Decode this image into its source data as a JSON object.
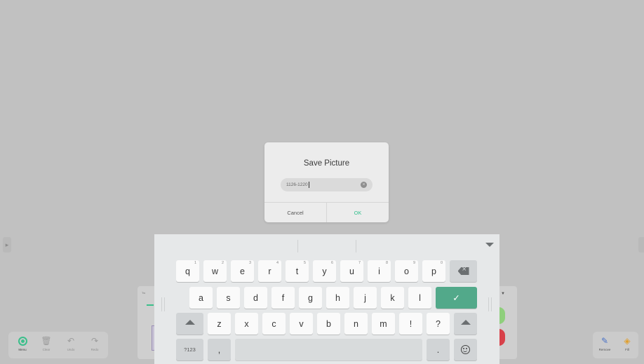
{
  "dialog": {
    "title": "Save Picture",
    "filename_value": "1126-1220",
    "cancel_label": "Cancel",
    "ok_label": "OK"
  },
  "toolbar_left": {
    "items": [
      {
        "label": "Menu",
        "icon": "menu-icon"
      },
      {
        "label": "Clear",
        "icon": "trash-icon"
      },
      {
        "label": "Undo",
        "icon": "undo-icon"
      },
      {
        "label": "Redo",
        "icon": "redo-icon"
      }
    ]
  },
  "toolbar_right": {
    "items": [
      {
        "label": "Remove",
        "icon": "eraser-icon"
      },
      {
        "label": "Fill",
        "icon": "fill-bucket-icon"
      }
    ]
  },
  "keyboard": {
    "row1": [
      {
        "key": "q",
        "hint": "1"
      },
      {
        "key": "w",
        "hint": "2"
      },
      {
        "key": "e",
        "hint": "3"
      },
      {
        "key": "r",
        "hint": "4"
      },
      {
        "key": "t",
        "hint": "5"
      },
      {
        "key": "y",
        "hint": "6"
      },
      {
        "key": "u",
        "hint": "7"
      },
      {
        "key": "i",
        "hint": "8"
      },
      {
        "key": "o",
        "hint": "9"
      },
      {
        "key": "p",
        "hint": "0"
      }
    ],
    "row2": [
      "a",
      "s",
      "d",
      "f",
      "g",
      "h",
      "j",
      "k",
      "l"
    ],
    "row3": [
      "z",
      "x",
      "c",
      "v",
      "b",
      "n",
      "m",
      "!",
      "?"
    ],
    "symbols_label": "?123",
    "comma_label": ",",
    "period_label": ".",
    "enter_glyph": "✓"
  },
  "colors": {
    "accent_green": "#3bbf8b",
    "enter_key": "#52a98a",
    "background": "#c1c1c1"
  }
}
